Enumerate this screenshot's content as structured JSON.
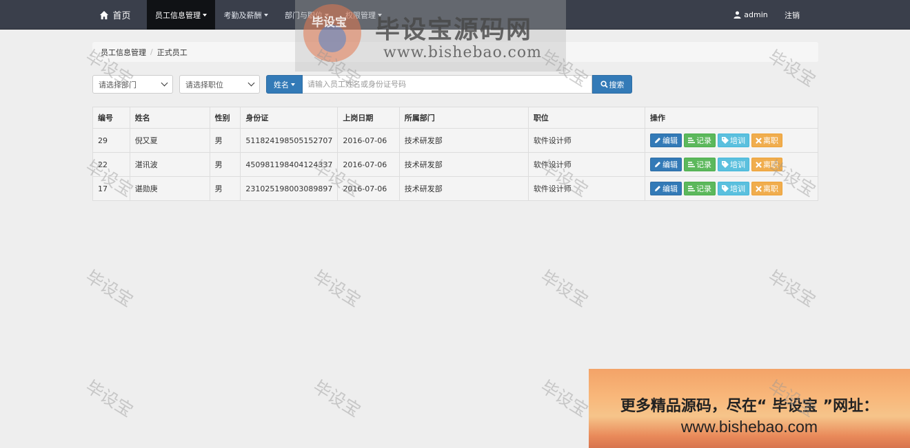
{
  "nav": {
    "home": "首页",
    "items": [
      "员工信息管理",
      "考勤及薪酬",
      "部门与职位",
      "权限管理"
    ],
    "user": "admin",
    "logout": "注销"
  },
  "breadcrumb": {
    "parent": "员工信息管理",
    "current": "正式员工"
  },
  "filters": {
    "department": "请选择部门",
    "position": "请选择职位",
    "search_type": "姓名",
    "search_placeholder": "请输入员工姓名或身份证号码",
    "search_button": "搜索"
  },
  "table": {
    "headers": [
      "编号",
      "姓名",
      "性别",
      "身份证",
      "上岗日期",
      "所属部门",
      "职位",
      "操作"
    ],
    "rows": [
      {
        "id": "29",
        "name": "倪又夏",
        "gender": "男",
        "idcard": "511824198505152707",
        "date": "2016-07-06",
        "dept": "技术研发部",
        "position": "软件设计师"
      },
      {
        "id": "22",
        "name": "湛讯波",
        "gender": "男",
        "idcard": "450981198404124337",
        "date": "2016-07-06",
        "dept": "技术研发部",
        "position": "软件设计师"
      },
      {
        "id": "17",
        "name": "谌勋庚",
        "gender": "男",
        "idcard": "231025198003089897",
        "date": "2016-07-06",
        "dept": "技术研发部",
        "position": "软件设计师"
      }
    ],
    "actions": {
      "edit": "编辑",
      "record": "记录",
      "train": "培训",
      "leave": "离职"
    }
  },
  "watermark": {
    "text": "毕设宝",
    "logo_emblem": "毕设宝",
    "logo_brand": "毕设宝源码网",
    "logo_url": "www.bishebao.com"
  },
  "ad": {
    "line1": "更多精品源码，尽在“ 毕设宝 ”网址：",
    "line2": "www.bishebao.com"
  },
  "colors": {
    "navbar": "#3a3f4b",
    "primary": "#337ab7",
    "success": "#5cb85c",
    "info": "#5bc0de",
    "warning": "#f0ad4e"
  }
}
